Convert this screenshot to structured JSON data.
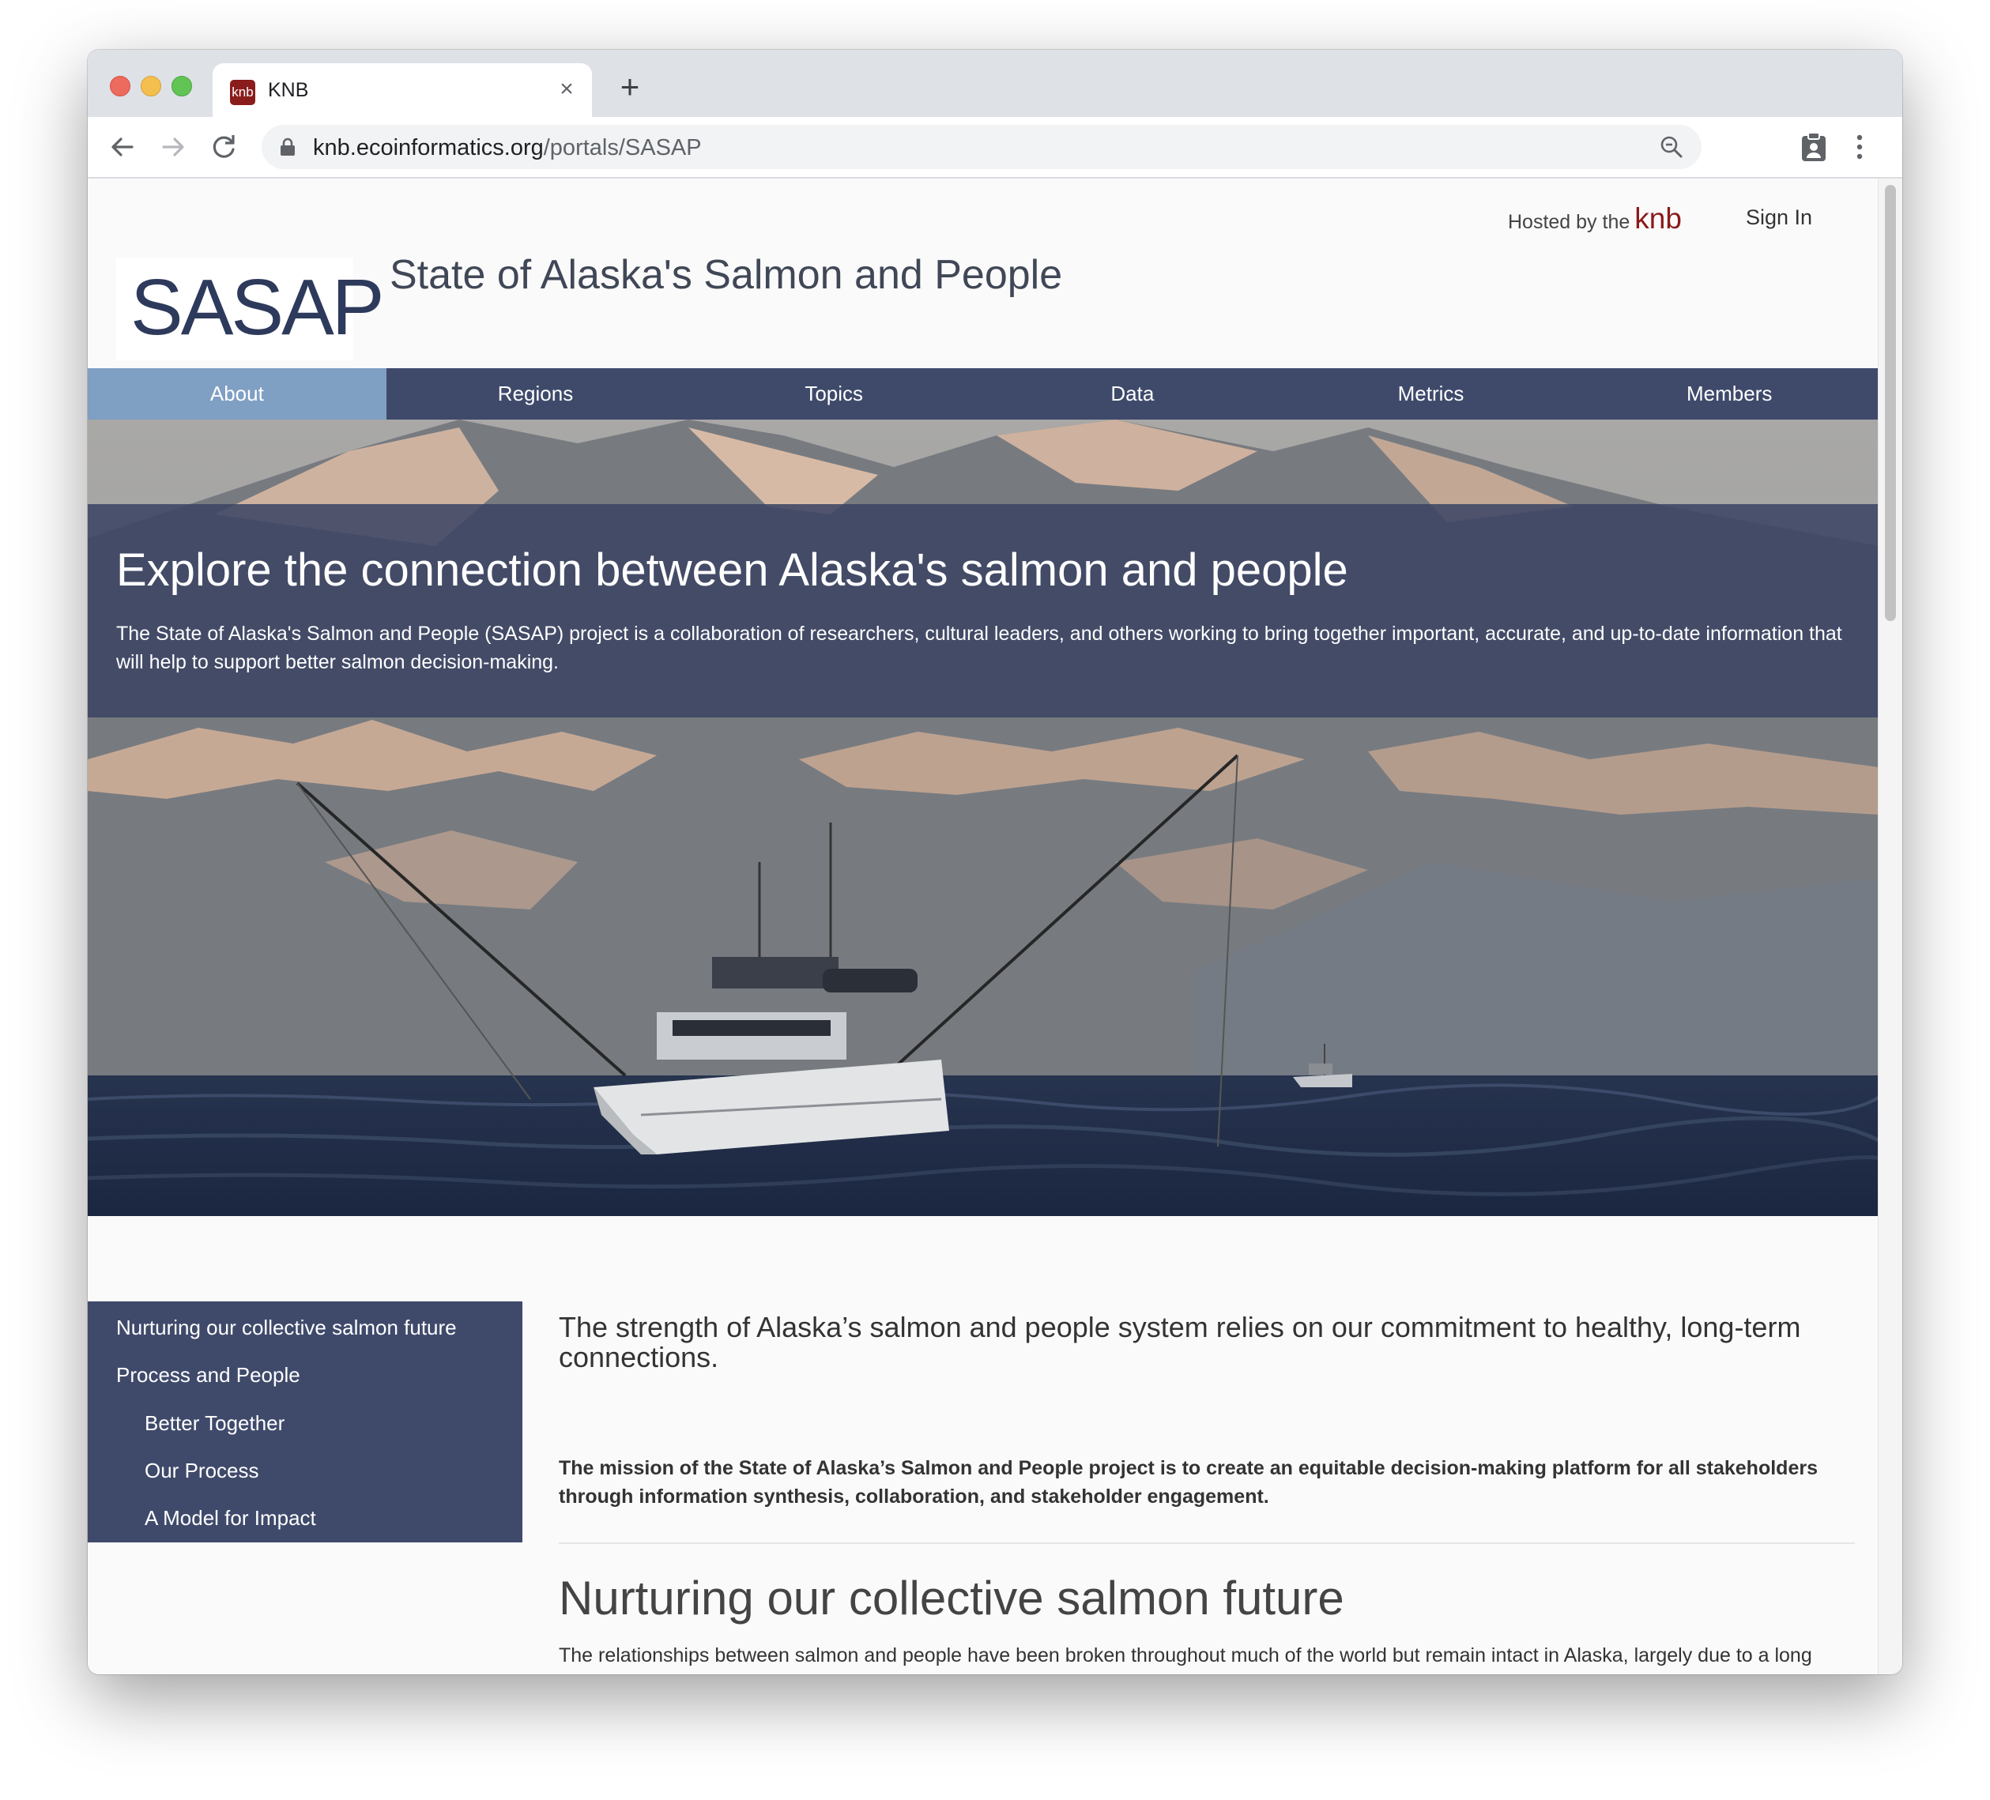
{
  "browser": {
    "tab": {
      "favicon_text": "knb",
      "title": "KNB",
      "close_symbol": "×"
    },
    "new_tab_symbol": "+",
    "address_bar": {
      "domain": "knb.ecoinformatics.org",
      "path": "/portals/SASAP"
    }
  },
  "site": {
    "hosted_by_label": "Hosted by the",
    "hosted_by_brand": "knb",
    "sign_in": "Sign In",
    "logo_text": "SASAP",
    "title": "State of Alaska's Salmon and People",
    "nav": {
      "active": "About",
      "items": [
        "About",
        "Regions",
        "Topics",
        "Data",
        "Metrics",
        "Members"
      ]
    },
    "hero": {
      "title": "Explore the connection between Alaska's salmon and people",
      "text": "The State of Alaska's Salmon and People (SASAP) project is a collaboration of researchers, cultural leaders, and others working to bring together important, accurate, and up-to-date information that will help to support better salmon decision-making."
    },
    "sidebar": {
      "items": [
        {
          "label": "Nurturing our collective salmon future",
          "level": 1
        },
        {
          "label": "Process and People",
          "level": 1
        },
        {
          "label": "Better Together",
          "level": 2
        },
        {
          "label": "Our Process",
          "level": 2
        },
        {
          "label": "A Model for Impact",
          "level": 2
        }
      ]
    },
    "content": {
      "lead": "The strength of Alaska’s salmon and people system relies on our commitment to healthy, long-term connections.",
      "mission": "The mission of the State of Alaska’s Salmon and People project is to create an equitable decision-making platform for all stakeholders through information synthesis, collaboration, and stakeholder engagement.",
      "section_heading": "Nurturing our collective salmon future",
      "section_text": "The relationships between salmon and people have been broken throughout much of the world but remain intact in Alaska, largely due to a long"
    }
  },
  "colors": {
    "nav_bg": "#3f4a6b",
    "nav_active": "#7f9fc3",
    "brand_red": "#8b1a1a",
    "logo": "#2e3a5c"
  }
}
